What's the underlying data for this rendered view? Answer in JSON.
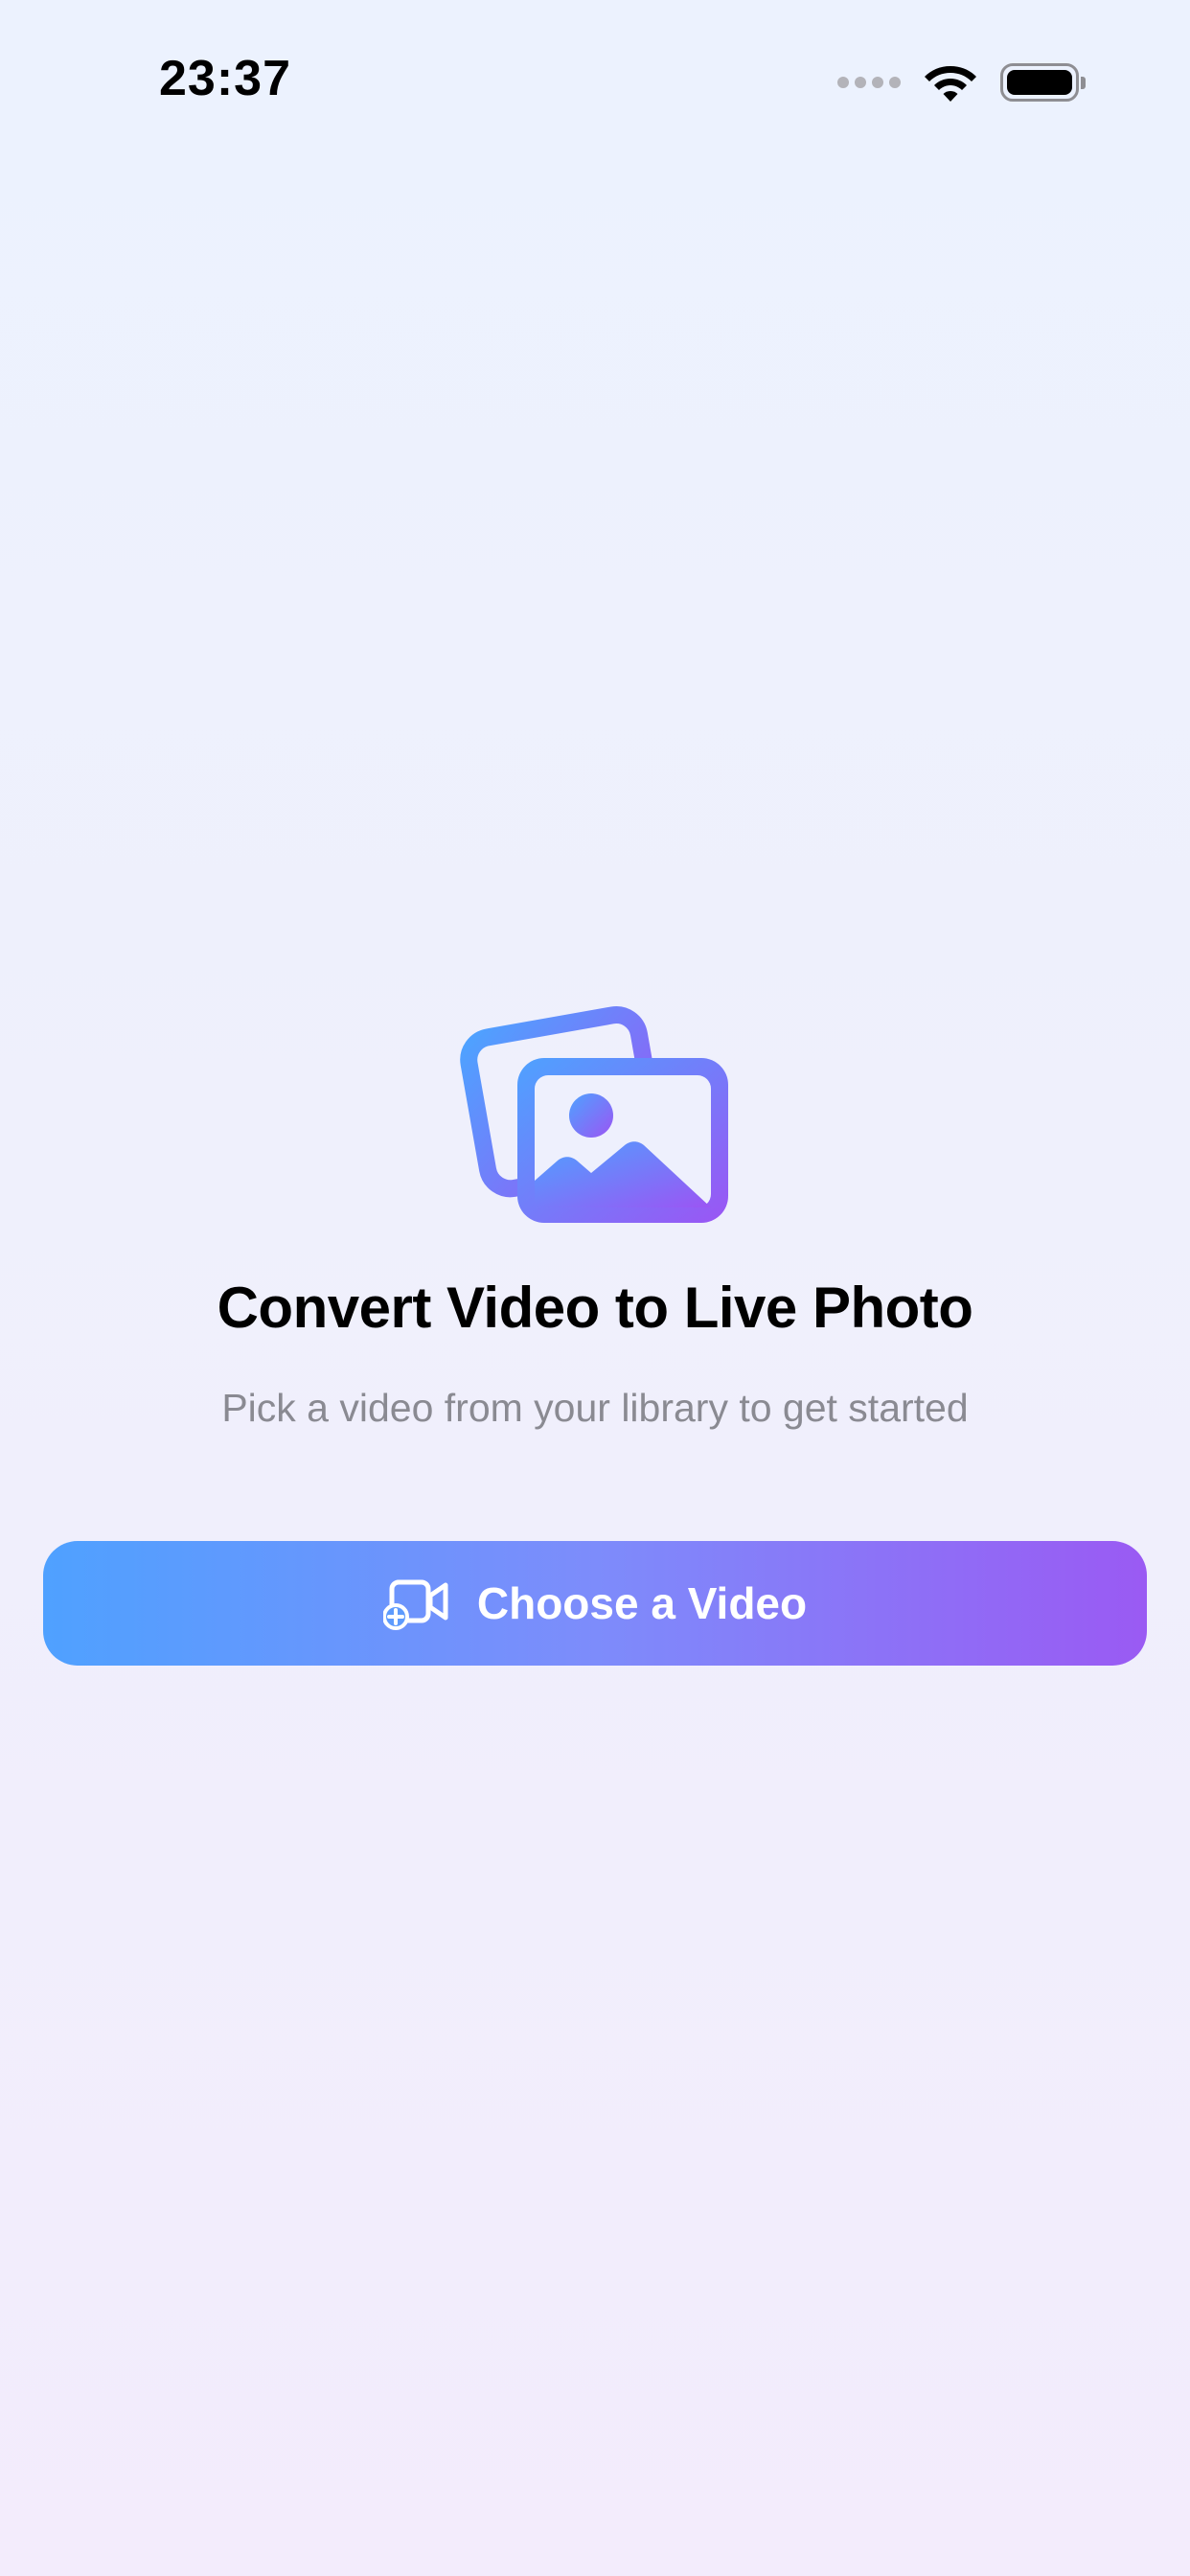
{
  "status_bar": {
    "time": "23:37",
    "icons": [
      "signal-icon",
      "wifi-icon",
      "battery-icon"
    ]
  },
  "hero": {
    "icon": "photo-stack-icon",
    "title": "Convert Video to Live Photo",
    "subtitle": "Pick a video from your library to get started"
  },
  "primary_action": {
    "icon": "video-add-icon",
    "label": "Choose a Video"
  },
  "colors": {
    "gradient_start": "#4fa1ff",
    "gradient_end": "#9a5af3",
    "title": "#000000",
    "subtitle": "#8a8a92"
  }
}
